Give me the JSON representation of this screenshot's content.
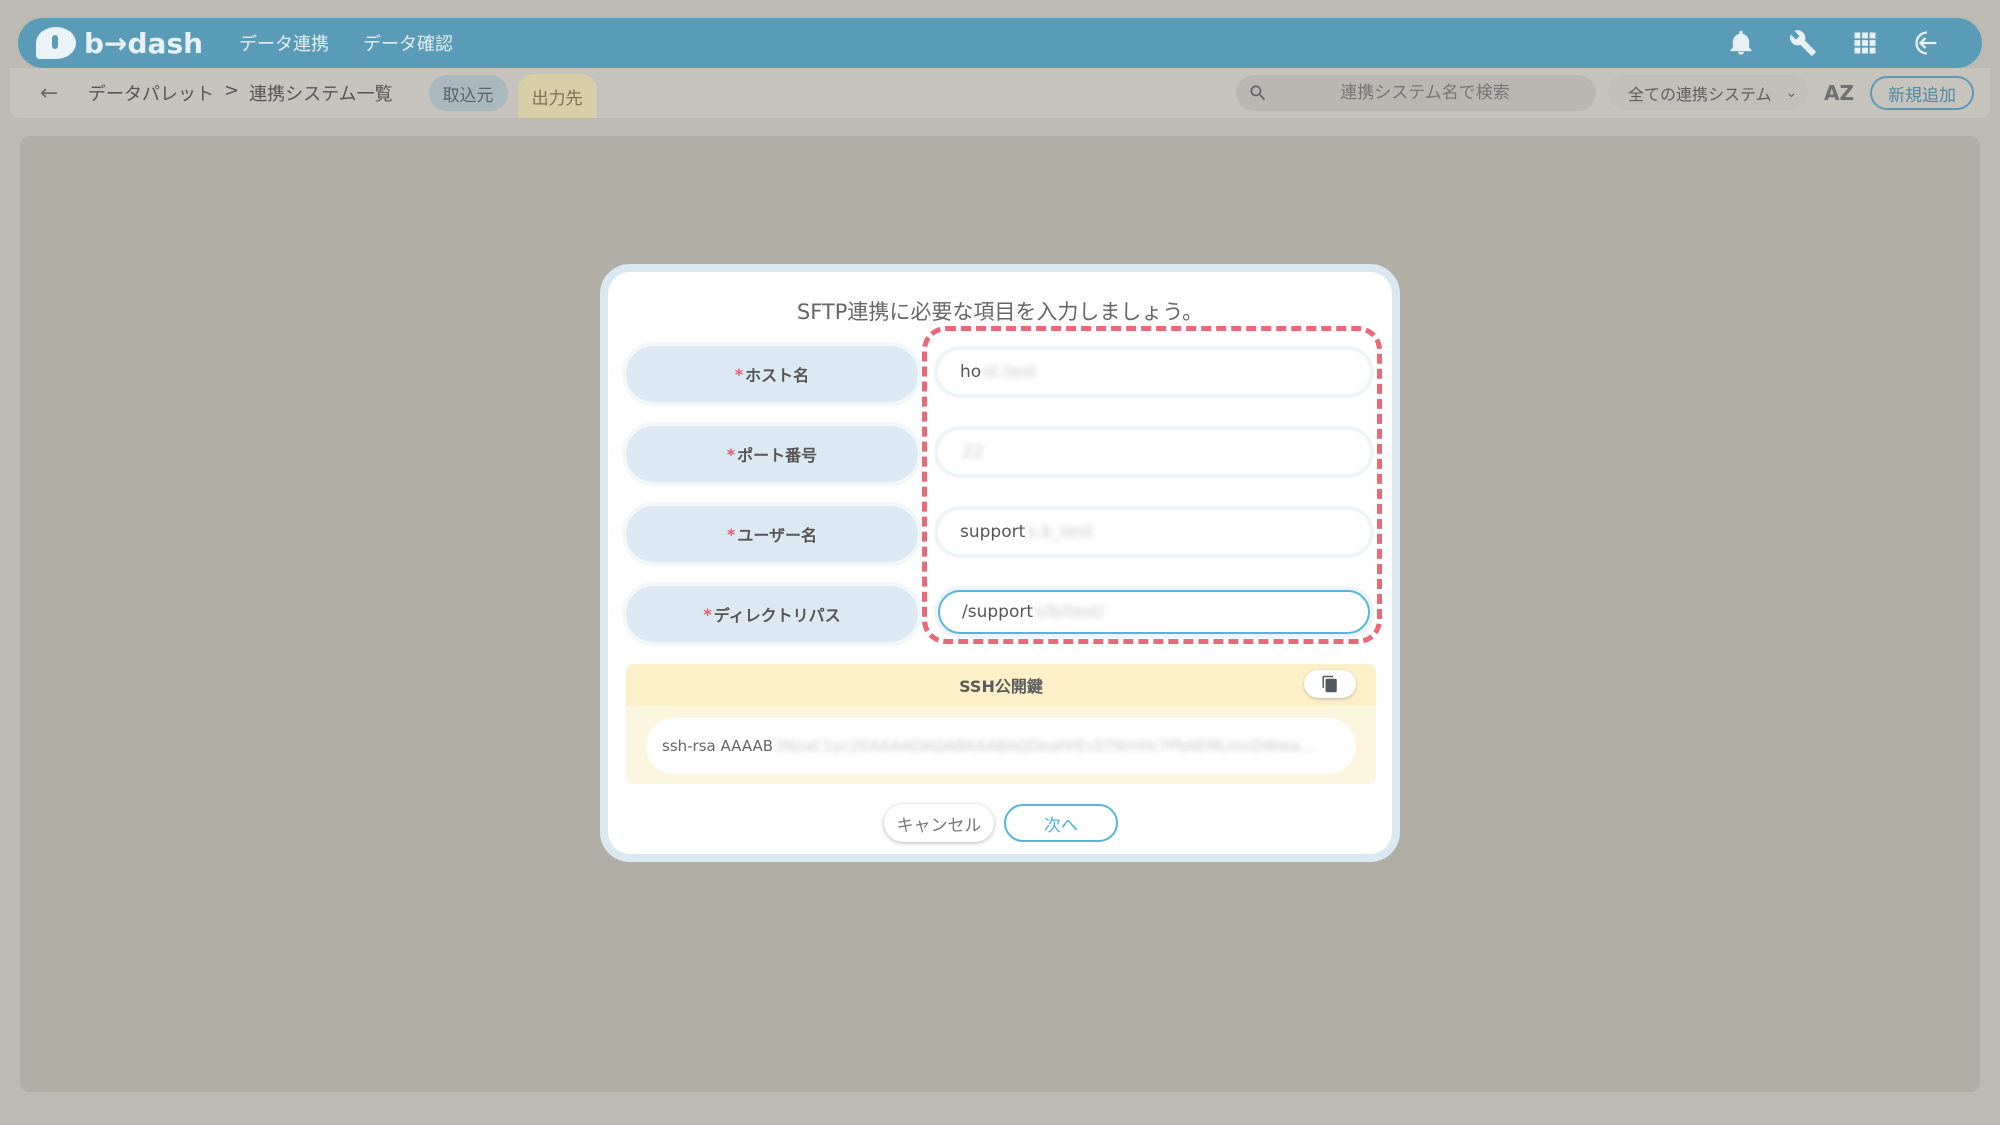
{
  "header": {
    "logo_text": "b→dash",
    "nav": [
      "データ連携",
      "データ確認"
    ],
    "icons": [
      "bell-icon",
      "wrench-icon",
      "grid-icon",
      "logout-icon"
    ]
  },
  "subbar": {
    "back_label": "←",
    "breadcrumb": [
      "データパレット",
      ">",
      "連携システム一覧"
    ],
    "tab_in": "取込元",
    "tab_out": "出力先",
    "search_placeholder": "連携システム名で検索",
    "filter_value": "全ての連携システム",
    "sort_label": "AZ",
    "add_button": "新規追加"
  },
  "modal": {
    "title": "SFTP連携に必要な項目を入力しましょう。",
    "required_mark": "*",
    "fields": [
      {
        "label": "ホスト名",
        "value": "ho",
        "blurred": "st.test"
      },
      {
        "label": "ポート番号",
        "value": "",
        "blurred": "22"
      },
      {
        "label": "ユーザー名",
        "value": "support",
        "blurred": "s.b_test"
      },
      {
        "label": "ディレクトリパス",
        "value": "/support",
        "blurred": "s/b/test/"
      }
    ],
    "ssh_title": "SSH公開鍵",
    "ssh_value": "ssh-rsa AAAAB",
    "ssh_blurred": "3NzaC1yc2EAAAADAQABAAABAQDeaHrEvSTNmHc7PbAEMLmnDWwa...",
    "cancel_label": "キャンセル",
    "next_label": "次へ"
  },
  "colors": {
    "header_bg": "#5a9cb8",
    "highlight_dashed": "#e86a78",
    "ssh_bg": "#fdf0c9",
    "accent": "#55b6d9"
  }
}
